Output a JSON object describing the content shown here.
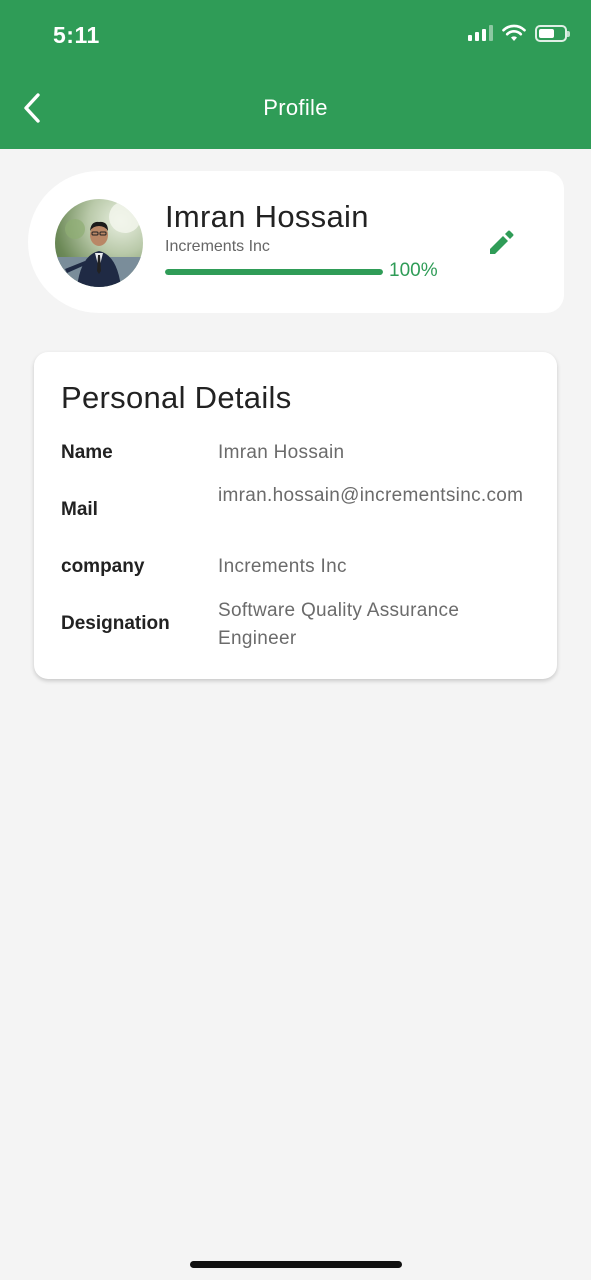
{
  "status_bar": {
    "time": "5:11",
    "battery_level": 0.62
  },
  "nav": {
    "title": "Profile",
    "back_icon": "chevron-left-icon"
  },
  "profile": {
    "name": "Imran Hossain",
    "company": "Increments Inc",
    "progress_percent": 100,
    "progress_label": "100%",
    "edit_icon": "pencil-icon"
  },
  "details": {
    "title": "Personal Details",
    "rows": [
      {
        "label": "Name",
        "value": "Imran Hossain"
      },
      {
        "label": "Mail",
        "value": "imran.hossain@incrementsinc.com"
      },
      {
        "label": "company",
        "value": "Increments Inc"
      },
      {
        "label": "Designation",
        "value": "Software Quality Assurance Engineer"
      }
    ]
  },
  "colors": {
    "accent": "#2f9c57",
    "background": "#f4f4f4",
    "card": "#ffffff"
  }
}
